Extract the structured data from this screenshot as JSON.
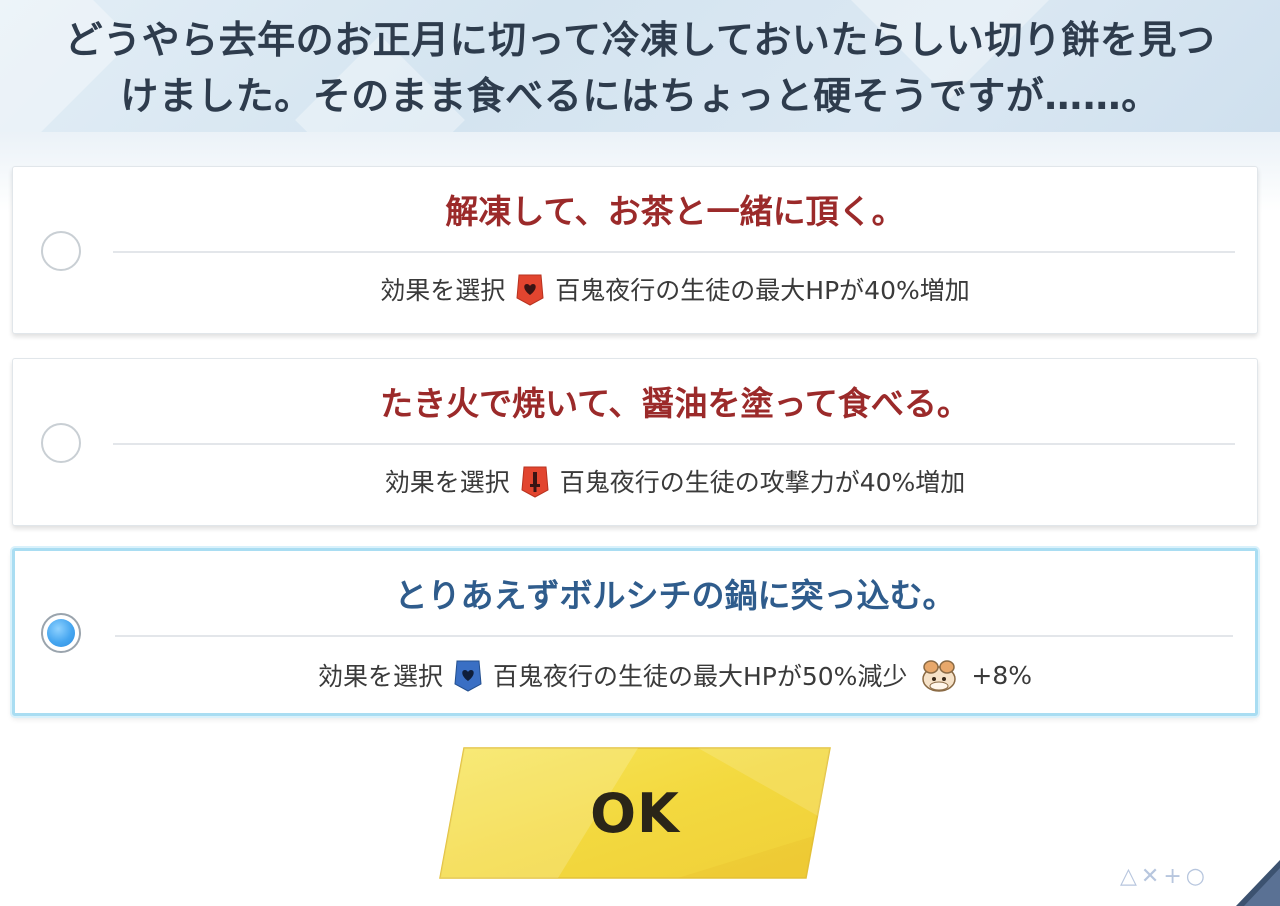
{
  "header": {
    "line1": "どうやら去年のお正月に切って冷凍しておいたらしい切り餅を見つ",
    "line2": "けました。そのまま食べるにはちょっと硬そうですが……。"
  },
  "choices": [
    {
      "title": "解凍して、お茶と一緒に頂く。",
      "effect_label": "効果を選択",
      "effect_text": "百鬼夜行の生徒の最大HPが40%増加",
      "icon": "heart-badge-icon",
      "selected": false
    },
    {
      "title": "たき火で焼いて、醤油を塗って食べる。",
      "effect_label": "効果を選択",
      "effect_text": "百鬼夜行の生徒の攻撃力が40%増加",
      "icon": "attack-badge-icon",
      "selected": false
    },
    {
      "title": "とりあえずボルシチの鍋に突っ込む。",
      "effect_label": "効果を選択",
      "effect_text": "百鬼夜行の生徒の最大HPが50%減少",
      "icon": "heart-down-badge-icon",
      "bonus_icon": "creature-icon",
      "bonus_text": "+8%",
      "selected": true
    }
  ],
  "ok_button": {
    "label": "OK"
  },
  "footer_symbols": "△✕+○",
  "colors": {
    "title_red": "#9b2a2a",
    "title_blue": "#2f5c8c",
    "badge_red": "#e2452f",
    "badge_blue": "#3a6fc4",
    "button_yellow": "#f5de4a"
  }
}
